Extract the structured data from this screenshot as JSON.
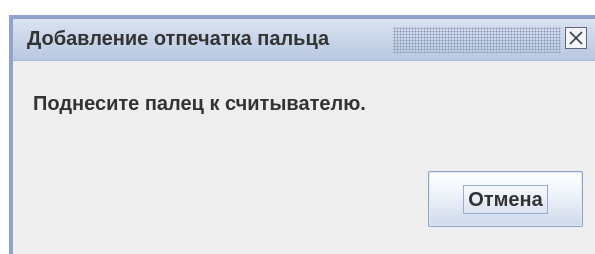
{
  "window": {
    "title": "Добавление отпечатка пальца",
    "close_icon": "close-icon"
  },
  "dialog": {
    "message": "Поднесите палец к считывателю.",
    "cancel_label": "Отмена"
  },
  "colors": {
    "frame_border": "#8ea4c8",
    "title_bar": "#c8d4e8",
    "body_background": "#eeeeee",
    "text": "#333333"
  }
}
